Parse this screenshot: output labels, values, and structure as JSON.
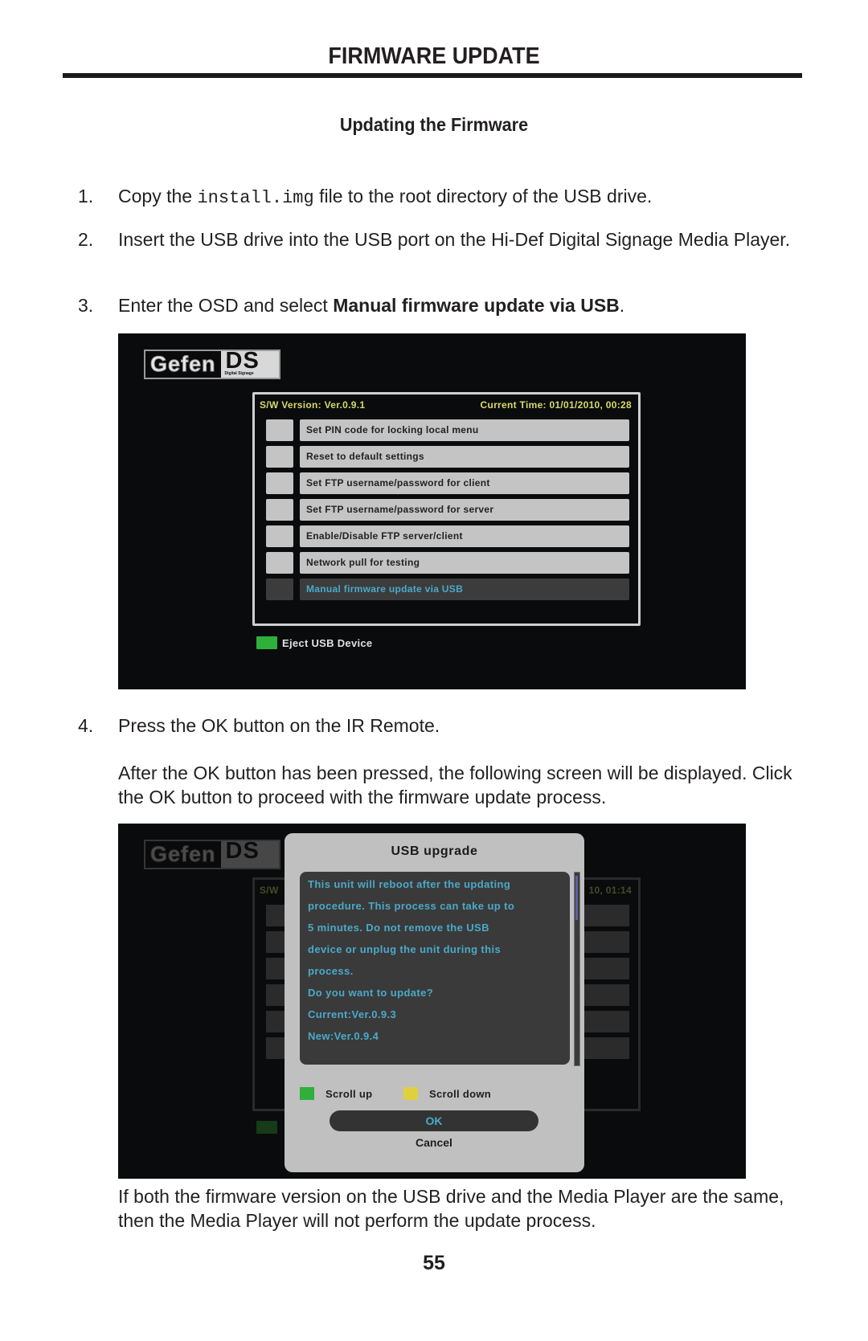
{
  "header": {
    "title": "FIRMWARE UPDATE",
    "subtitle": "Updating the Firmware"
  },
  "steps": [
    {
      "num": "1.",
      "pre": "Copy the ",
      "code": "install.img",
      "post": " file to the root directory of the USB drive."
    },
    {
      "num": "2.",
      "text": "Insert the USB drive into the USB port on the Hi-Def Digital Signage Media Player."
    },
    {
      "num": "3.",
      "pre": "Enter the OSD and select ",
      "bold": "Manual firmware update via USB",
      "post": "."
    },
    {
      "num": "4.",
      "text": "Press the OK button on the IR Remote."
    }
  ],
  "after_ok_text": "After the OK button has been pressed, the following screen will be displayed. Click the OK button to proceed with the firmware update process.",
  "closing_text": "If both the firmware version on the USB drive and the Media Player are the same, then the Media Player will not perform the update process.",
  "page_number": "55",
  "osd_menu": {
    "logo_left": "Gefen",
    "logo_right": "DS",
    "logo_tagline": "Digital Signage",
    "sw_version": "S/W Version: Ver.0.9.1",
    "current_time": "Current Time: 01/01/2010, 00:28",
    "items": [
      {
        "label": "Set PIN code for locking local menu",
        "selected": false
      },
      {
        "label": "Reset to default settings",
        "selected": false
      },
      {
        "label": "Set FTP username/password for client",
        "selected": false
      },
      {
        "label": "Set FTP username/password for server",
        "selected": false
      },
      {
        "label": "Enable/Disable FTP server/client",
        "selected": false
      },
      {
        "label": "Network pull for testing",
        "selected": false
      },
      {
        "label": "Manual firmware update via USB",
        "selected": true
      }
    ],
    "eject_label": "Eject USB Device"
  },
  "usb_dialog": {
    "background_sw": "S/W",
    "background_time": "10, 01:14",
    "title": "USB upgrade",
    "lines": [
      "This unit will reboot after the updating",
      "procedure. This process can take up to",
      "5 minutes. Do not remove the USB",
      "device or unplug the unit during this",
      "process.",
      "Do you want to update?",
      "Current:Ver.0.9.3",
      "New:Ver.0.9.4"
    ],
    "scroll_up": "Scroll up",
    "scroll_down": "Scroll down",
    "ok": "OK",
    "cancel": "Cancel"
  },
  "colors": {
    "osd_yellow": "#d9d96a",
    "osd_highlight_text": "#4aa9c9",
    "key_green": "#2fb03a",
    "key_yellow": "#e0d040"
  }
}
